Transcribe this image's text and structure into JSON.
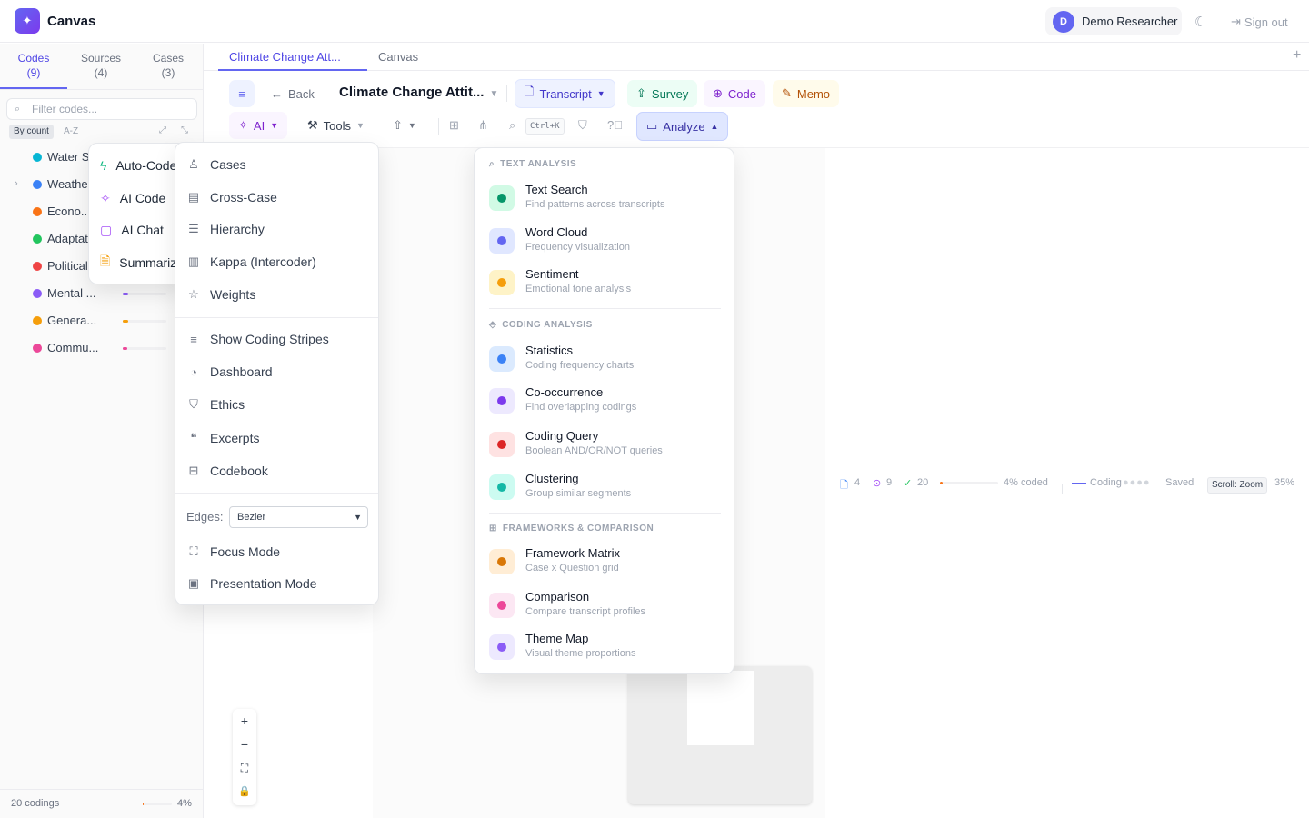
{
  "app": {
    "logo_glyph": "✦",
    "name": "Canvas"
  },
  "user": {
    "initial": "D",
    "name": "Demo Researcher",
    "signout": "Sign out"
  },
  "sidebar": {
    "tabs": [
      {
        "label": "Codes",
        "count": "(9)",
        "active": true
      },
      {
        "label": "Sources",
        "count": "(4)"
      },
      {
        "label": "Cases",
        "count": "(3)"
      }
    ],
    "filter_placeholder": "Filter codes...",
    "sort_options": [
      "By count",
      "A-Z"
    ],
    "codes": [
      {
        "name": "Water S...",
        "color": "#06b6d4",
        "fraction": 0.35
      },
      {
        "name": "Weathe...",
        "color": "#3b82f6",
        "fraction": 0.3,
        "expandable": true
      },
      {
        "name": "Econo...",
        "color": "#f97316",
        "fraction": 0.25
      },
      {
        "name": "Adaptat...",
        "color": "#22c55e",
        "fraction": 0.2
      },
      {
        "name": "Political ...",
        "color": "#ef4444",
        "fraction": 0.15
      },
      {
        "name": "Mental ...",
        "color": "#8b5cf6",
        "fraction": 0.12
      },
      {
        "name": "Genera...",
        "color": "#f59e0b",
        "fraction": 0.12
      },
      {
        "name": "Commu...",
        "color": "#ec4899",
        "fraction": 0.1
      }
    ],
    "footer": {
      "codings": "20 codings",
      "percent": "4%",
      "fraction": 0.04
    }
  },
  "doc_tabs": [
    "Climate Change Att...",
    "Canvas"
  ],
  "toolbar": {
    "back": "Back",
    "doc_title": "Climate Change Attit...",
    "transcript": "Transcript",
    "survey": "Survey",
    "code": "Code",
    "memo": "Memo",
    "ai": "AI",
    "tools": "Tools",
    "search_shortcut": "Ctrl+K",
    "analyze": "Analyze"
  },
  "ai_menu": {
    "items": [
      {
        "label": "Auto-Code",
        "icon": "bolt-icon",
        "color": "#10b981"
      },
      {
        "label": "AI Code",
        "icon": "sparkle-icon",
        "color": "#a855f7"
      },
      {
        "label": "AI Chat",
        "icon": "chat-icon",
        "color": "#a855f7"
      },
      {
        "label": "Summarize",
        "icon": "document-icon",
        "color": "#f59e0b"
      }
    ]
  },
  "tools_menu": {
    "group1": [
      {
        "label": "Cases",
        "icon": "user-icon"
      },
      {
        "label": "Cross-Case",
        "icon": "table-icon"
      },
      {
        "label": "Hierarchy",
        "icon": "list-icon"
      },
      {
        "label": "Kappa (Intercoder)",
        "icon": "bar-chart-icon"
      },
      {
        "label": "Weights",
        "icon": "star-icon"
      }
    ],
    "group2": [
      {
        "label": "Show Coding Stripes",
        "icon": "lines-icon"
      },
      {
        "label": "Dashboard",
        "icon": "pie-chart-icon"
      },
      {
        "label": "Ethics",
        "icon": "shield-icon"
      },
      {
        "label": "Excerpts",
        "icon": "quote-icon"
      },
      {
        "label": "Codebook",
        "icon": "book-icon"
      }
    ],
    "edges_label": "Edges:",
    "edges_value": "Bezier",
    "group3": [
      {
        "label": "Focus Mode",
        "icon": "focus-icon"
      },
      {
        "label": "Presentation Mode",
        "icon": "presentation-icon"
      }
    ]
  },
  "analyze_menu": {
    "sections": [
      {
        "title": "TEXT ANALYSIS",
        "icon": "search-icon",
        "items": [
          {
            "title": "Text Search",
            "subtitle": "Find patterns across transcripts",
            "color": "#059669",
            "bg": "#d1fae5"
          },
          {
            "title": "Word Cloud",
            "subtitle": "Frequency visualization",
            "color": "#6366f1",
            "bg": "#e0e7ff"
          },
          {
            "title": "Sentiment",
            "subtitle": "Emotional tone analysis",
            "color": "#f59e0b",
            "bg": "#fef3c7"
          }
        ]
      },
      {
        "title": "CODING ANALYSIS",
        "icon": "tag-icon",
        "items": [
          {
            "title": "Statistics",
            "subtitle": "Coding frequency charts",
            "color": "#3b82f6",
            "bg": "#dbeafe"
          },
          {
            "title": "Co-occurrence",
            "subtitle": "Find overlapping codings",
            "color": "#7c3aed",
            "bg": "#ede9fe"
          },
          {
            "title": "Coding Query",
            "subtitle": "Boolean AND/OR/NOT queries",
            "color": "#dc2626",
            "bg": "#fee2e2"
          },
          {
            "title": "Clustering",
            "subtitle": "Group similar segments",
            "color": "#14b8a6",
            "bg": "#ccfbf1"
          }
        ]
      },
      {
        "title": "FRAMEWORKS & COMPARISON",
        "icon": "grid-icon",
        "items": [
          {
            "title": "Framework Matrix",
            "subtitle": "Case x Question grid",
            "color": "#d97706",
            "bg": "#ffedd5"
          },
          {
            "title": "Comparison",
            "subtitle": "Compare transcript profiles",
            "color": "#ec4899",
            "bg": "#fce7f3"
          },
          {
            "title": "Theme Map",
            "subtitle": "Visual theme proportions",
            "color": "#8b5cf6",
            "bg": "#ede9fe"
          }
        ]
      }
    ]
  },
  "status": {
    "sources": "4",
    "codes": "9",
    "codings": "20",
    "coded_fraction": 0.04,
    "coded_label": "4% coded",
    "mode": "Coding",
    "saved": "Saved",
    "scroll": "Scroll: Zoom",
    "zoom": "35%"
  }
}
